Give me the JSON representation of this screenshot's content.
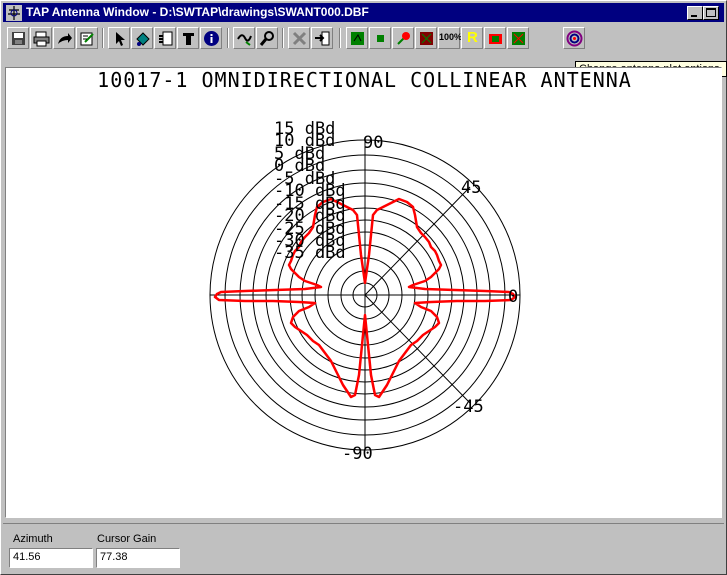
{
  "window": {
    "title": "TAP Antenna Window - D:\\SWTAP\\drawings\\SWANT000.DBF"
  },
  "toolbar": {
    "tooltip": "Change antenna plot options.",
    "buttons": [
      {
        "name": "save-icon"
      },
      {
        "name": "print-icon"
      },
      {
        "name": "export-arrow-icon"
      },
      {
        "name": "edit-notes-icon"
      },
      {
        "name": "pointer-icon"
      },
      {
        "name": "paint-icon"
      },
      {
        "name": "document-icon"
      },
      {
        "name": "text-tool-icon"
      },
      {
        "name": "info-icon"
      },
      {
        "name": "measure-icon"
      },
      {
        "name": "zoom-icon"
      },
      {
        "name": "delete-icon"
      },
      {
        "name": "exit-icon"
      },
      {
        "name": "plot-green-icon"
      },
      {
        "name": "plot-small-icon"
      },
      {
        "name": "pattern-red-icon"
      },
      {
        "name": "plot-red-icon"
      },
      {
        "name": "percent-icon"
      },
      {
        "name": "rotate-icon"
      },
      {
        "name": "scale-icon"
      },
      {
        "name": "plot-grid-icon"
      },
      {
        "name": "plot-options-icon"
      }
    ],
    "percent_label": "100%",
    "rotate_label": "R"
  },
  "plot": {
    "title": "10017-1 OMNIDIRECTIONAL COLLINEAR ANTENNA",
    "ring_labels": [
      "15 dBd",
      "10 dBd",
      "5 dBd",
      "0 dBd",
      "-5 dBd",
      "-10 dBd",
      "-15 dBd",
      "-20 dBd",
      "-25 dBd",
      "-30 dBd",
      "-35 dBd"
    ],
    "angle_labels": {
      "top": "90",
      "upper_right": "45",
      "right": "0",
      "lower_right": "-45",
      "bottom": "-90"
    },
    "colors": {
      "trace": "#ff0000",
      "grid": "#000000"
    }
  },
  "status": {
    "azimuth_label": "Azimuth",
    "azimuth_value": "41.56",
    "gain_label": "Cursor Gain",
    "gain_value": "77.38"
  }
}
